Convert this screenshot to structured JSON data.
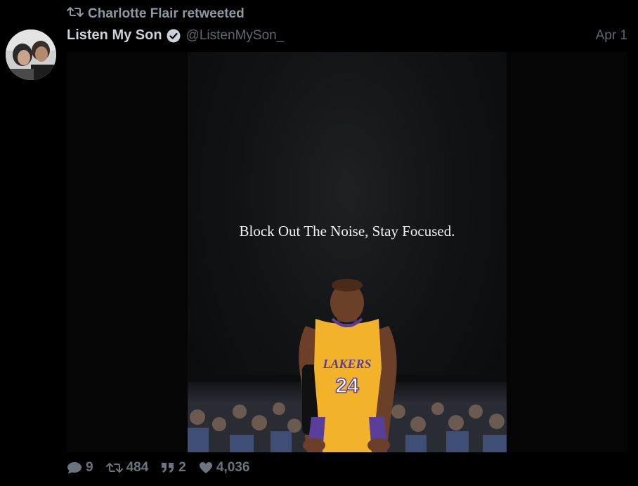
{
  "retweet": {
    "label": "Charlotte Flair retweeted",
    "icon": "retweet-icon"
  },
  "tweet": {
    "display_name": "Listen My Son",
    "handle": "@ListenMySon_",
    "date": "Apr 1",
    "verified": true
  },
  "media": {
    "caption": "Block Out The Noise, Stay Focused.",
    "jersey_text": "LAKERS",
    "jersey_number": "24"
  },
  "actions": {
    "replies": "9",
    "retweets": "484",
    "quotes": "2",
    "likes": "4,036"
  },
  "colors": {
    "background": "#000000",
    "name": "#c9d3db",
    "muted": "#5d6872",
    "action": "#6a7580",
    "verified_badge": "#c9d3db",
    "jersey": "#f2b32a",
    "shorts": "#5a3e9c"
  }
}
